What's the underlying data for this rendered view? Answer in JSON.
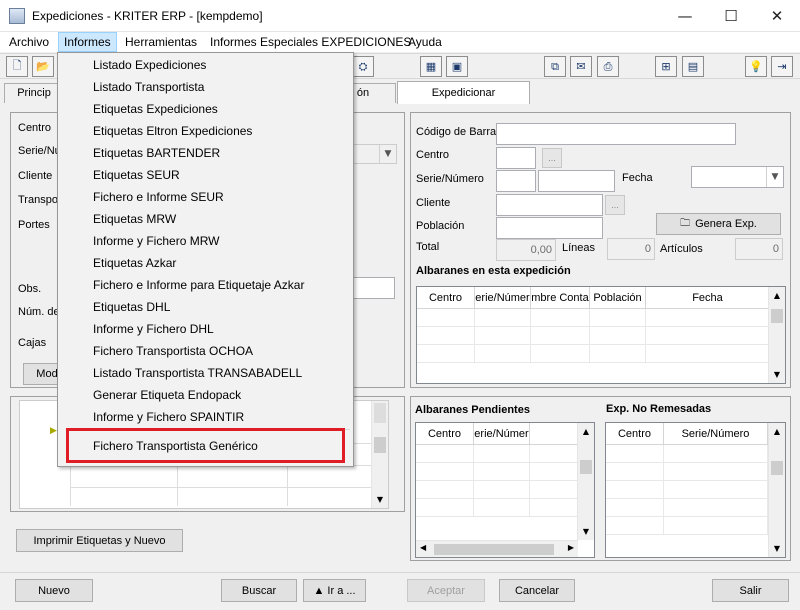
{
  "window": {
    "title": "Expediciones - KRITER ERP - [kempdemo]",
    "minimize": "—",
    "maximize": "☐",
    "close": "✕"
  },
  "menubar": [
    "Archivo",
    "Informes",
    "Herramientas",
    "Informes Especiales EXPEDICIONES",
    "Ayuda"
  ],
  "informes_menu": [
    "Listado Expediciones",
    "Listado Transportista",
    "Etiquetas Expediciones",
    "Etiquetas Eltron Expediciones",
    "Etiquetas BARTENDER",
    "Etiquetas SEUR",
    "Fichero e Informe SEUR",
    "Etiquetas MRW",
    "Informe y Fichero MRW",
    "Etiquetas Azkar",
    "Fichero e Informe para Etiquetaje Azkar",
    "Etiquetas DHL",
    "Informe y Fichero DHL",
    "Fichero Transportista OCHOA",
    "Listado Transportista TRANSABADELL",
    "Generar Etiqueta Endopack",
    "Informe y Fichero SPAINTIR",
    "Fichero Transportista Genérico"
  ],
  "highlight_color": "#e01c24",
  "tabs": {
    "t1": "Princip",
    "t2": "ón",
    "t3": "Expedicionar"
  },
  "left_form": {
    "centro": "Centro",
    "serie": "Serie/Nu",
    "cliente": "Cliente",
    "transporte": "Transpo",
    "portes": "Portes",
    "obs": "Obs.",
    "num": "Núm. de",
    "cajas": "Cajas",
    "mod_button": "Mod",
    "print_button": "Imprimir Etiquetas y Nuevo"
  },
  "right_form": {
    "codigo_barras": "Código de Barras",
    "centro": "Centro",
    "serie_numero": "Serie/Número",
    "fecha": "Fecha",
    "cliente": "Cliente",
    "poblacion": "Población",
    "genera_button": "Genera Exp.",
    "total": "Total",
    "total_value": "0,00",
    "lineas": "Líneas",
    "lineas_value": "0",
    "articulos": "Artículos",
    "articulos_value": "0",
    "ellipsis": "..."
  },
  "albaranes_expedicion": {
    "title": "Albaranes en esta expedición",
    "columns": [
      "Centro",
      "erie/Númer",
      "mbre Conta",
      "Población",
      "Fecha"
    ]
  },
  "albaranes_pendientes": {
    "title": "Albaranes Pendientes",
    "columns": [
      "Centro",
      "erie/Númer"
    ]
  },
  "exp_no_remesadas": {
    "title": "Exp. No Remesadas",
    "columns": [
      "Centro",
      "Serie/Número"
    ]
  },
  "bottom_buttons": {
    "nuevo": "Nuevo",
    "buscar": "Buscar",
    "ir_a": "▲ Ir a ...",
    "aceptar": "Aceptar",
    "cancelar": "Cancelar",
    "salir": "Salir"
  }
}
